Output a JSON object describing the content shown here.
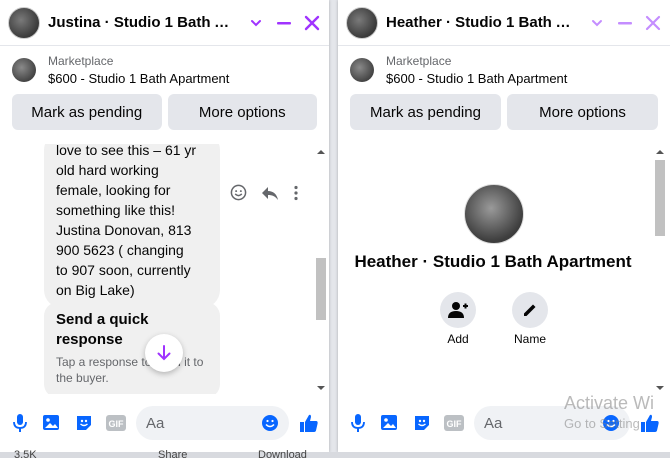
{
  "colors": {
    "accent": "#a033ff",
    "blue": "#0084ff",
    "like": "#0866ff"
  },
  "chat1": {
    "title": "Justina · Studio 1 Bath Apa...",
    "marketplace_label": "Marketplace",
    "listing": "$600 - Studio 1 Bath Apartment",
    "mark_pending": "Mark as pending",
    "more_options": "More options",
    "message_lines": [
      "love to see this – 61 yr",
      "old hard working",
      "female, looking for",
      "something like this!",
      "Justina Donovan, 813",
      "900 5623 ( changing",
      "to 907 soon, currently",
      "on Big Lake)"
    ],
    "quick_title": "Send a quick response",
    "quick_sub": "Tap a response to send it to the buyer.",
    "composer_placeholder": "Aa"
  },
  "chat2": {
    "title": "Heather · Studio 1 Bath Apa...",
    "marketplace_label": "Marketplace",
    "listing": "$600 - Studio 1 Bath Apartment",
    "mark_pending": "Mark as pending",
    "more_options": "More options",
    "profile_name": "Heather · Studio 1 Bath Apartment",
    "add_label": "Add",
    "name_label": "Name",
    "composer_placeholder": "Aa"
  },
  "watermark": {
    "line1": "Activate Wi",
    "line2": "Go to Setting"
  },
  "bottom_strip": {
    "left": "3.5K",
    "share": "Share",
    "download": "Download"
  }
}
